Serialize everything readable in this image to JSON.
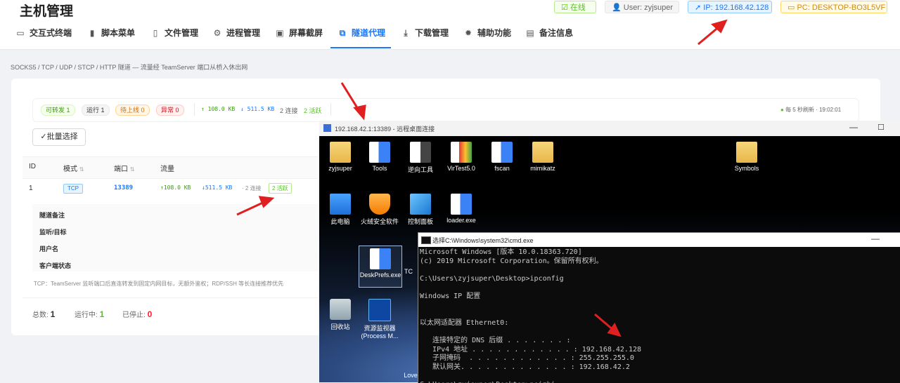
{
  "header": {
    "title": "主机管理",
    "status": "在线",
    "user": "User: zyjsuper",
    "ip": "IP: 192.168.42.128",
    "pc": "PC: DESKTOP-BO3L5VF"
  },
  "tabs": [
    {
      "label": "交互式终端",
      "icon": "terminal-icon"
    },
    {
      "label": "脚本菜单",
      "icon": "file-icon"
    },
    {
      "label": "文件管理",
      "icon": "document-icon"
    },
    {
      "label": "进程管理",
      "icon": "chip-icon"
    },
    {
      "label": "屏幕截屏",
      "icon": "image-icon"
    },
    {
      "label": "隧道代理",
      "icon": "tunnel-icon"
    },
    {
      "label": "下载管理",
      "icon": "download-icon"
    },
    {
      "label": "辅助功能",
      "icon": "gear-icon"
    },
    {
      "label": "备注信息",
      "icon": "note-icon"
    }
  ],
  "description": "SOCKS5 / TCP / UDP / STCP / HTTP 隧道 — 流量经 TeamServer 端口从桥入休出网",
  "stats": {
    "forwardable": "可转发 1",
    "running": "运行 1",
    "pending": "待上线 0",
    "error": "异常 0",
    "up": "↑ 108.0 KB",
    "down": "↓ 511.5 KB",
    "conns": "2 连接",
    "active": "2 活跃",
    "refresh": "每 5 秒刷新 · 19:02:01"
  },
  "batch_select": "✓批量选择",
  "table": {
    "headers": [
      "ID",
      "模式",
      "端口",
      "流量"
    ],
    "row": {
      "id": "1",
      "mode": "TCP",
      "port": "13389",
      "up": "↑108.0 KB",
      "down": "↓511.5 KB",
      "conn": "2 连接",
      "active": "2 活跃"
    }
  },
  "detail_labels": [
    "隧道备注",
    "监听/目标",
    "用户名",
    "客户端状态"
  ],
  "footer_note": "TCP：TeamServer 监听端口后直连转发到固定内网目标，无额外鉴权；RDP/SSH 等长连接推荐优先",
  "footer": {
    "total_label": "总数:",
    "total": "1",
    "running_label": "运行中:",
    "running": "1",
    "stopped_label": "已停止:",
    "stopped": "0"
  },
  "rdp": {
    "title": "192.168.42.1:13389 - 远程桌面连接",
    "icons": [
      "zyjsuper",
      "Tools",
      "逆向工具",
      "VirTest5.0",
      "fscan",
      "mimikatz",
      "Symbols",
      "此电脑",
      "火绒安全软件",
      "控制面板",
      "loader.exe",
      "DeskPrefs.exe",
      "TC",
      "回收站",
      "资源监视器 (Process M...",
      "Love"
    ]
  },
  "cmd": {
    "title": "选择C:\\Windows\\system32\\cmd.exe",
    "lines": [
      "Microsoft Windows [版本 10.0.18363.720]",
      "(c) 2019 Microsoft Corporation。保留所有权利。",
      "",
      "C:\\Users\\zyjsuper\\Desktop>ipconfig",
      "",
      "Windows IP 配置",
      "",
      "",
      "以太网适配器 Ethernet0:",
      "",
      "   连接特定的 DNS 后缀 . . . . . . . :",
      "   IPv4 地址 . . . . . . . . . . . . : 192.168.42.128",
      "   子网掩码  . . . . . . . . . . . . : 255.255.255.0",
      "   默认网关. . . . . . . . . . . . . : 192.168.42.2",
      "",
      "C:\\Users\\zyjsuper\\Desktop>peizhi"
    ]
  },
  "colors": {
    "accent": "#1677ff",
    "green": "#52c41a",
    "orange": "#fa8c16",
    "red": "#f5222d",
    "annotation": "#e02020"
  }
}
